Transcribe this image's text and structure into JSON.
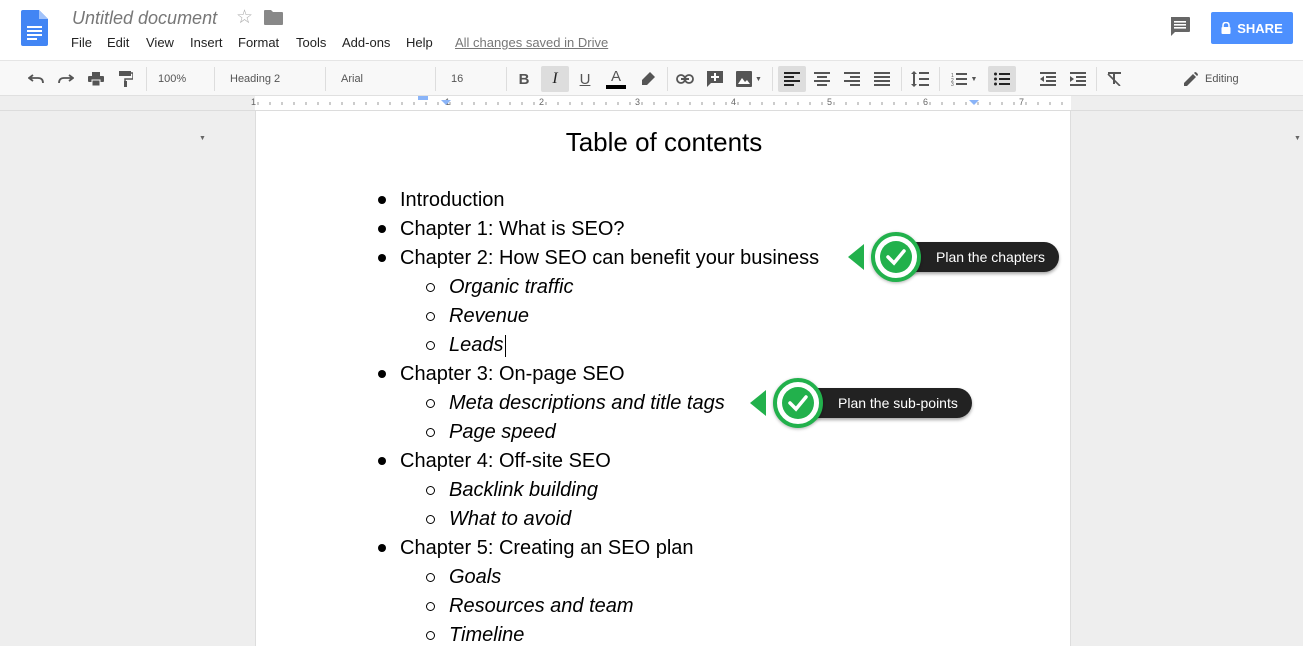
{
  "header": {
    "title": "Untitled document",
    "menu": [
      "File",
      "Edit",
      "View",
      "Insert",
      "Format",
      "Tools",
      "Add-ons",
      "Help"
    ],
    "saved_status": "All changes saved in Drive",
    "share_label": "SHARE"
  },
  "toolbar": {
    "zoom": "100%",
    "style": "Heading 2",
    "font": "Arial",
    "size": "16",
    "mode": "Editing"
  },
  "ruler": {
    "numbers": [
      "1",
      "1",
      "2",
      "3",
      "4",
      "5",
      "6",
      "7"
    ]
  },
  "document": {
    "title": "Table of contents",
    "items": [
      {
        "level": 1,
        "text": "Introduction"
      },
      {
        "level": 1,
        "text": "Chapter 1: What is SEO?"
      },
      {
        "level": 1,
        "text": "Chapter 2: How SEO can benefit your business"
      },
      {
        "level": 2,
        "text": "Organic traffic"
      },
      {
        "level": 2,
        "text": "Revenue"
      },
      {
        "level": 2,
        "text": "Leads"
      },
      {
        "level": 1,
        "text": "Chapter 3: On-page SEO"
      },
      {
        "level": 2,
        "text": "Meta descriptions and title tags"
      },
      {
        "level": 2,
        "text": "Page speed"
      },
      {
        "level": 1,
        "text": "Chapter 4: Off-site SEO"
      },
      {
        "level": 2,
        "text": "Backlink building"
      },
      {
        "level": 2,
        "text": "What to avoid"
      },
      {
        "level": 1,
        "text": "Chapter 5:  Creating an SEO plan"
      },
      {
        "level": 2,
        "text": "Goals"
      },
      {
        "level": 2,
        "text": "Resources and team"
      },
      {
        "level": 2,
        "text": "Timeline"
      }
    ]
  },
  "callouts": [
    {
      "text": "Plan the chapters"
    },
    {
      "text": "Plan the sub-points"
    }
  ],
  "colors": {
    "share_blue": "#4d90fe",
    "callout_green": "#22b14c",
    "callout_dark": "#222222"
  }
}
